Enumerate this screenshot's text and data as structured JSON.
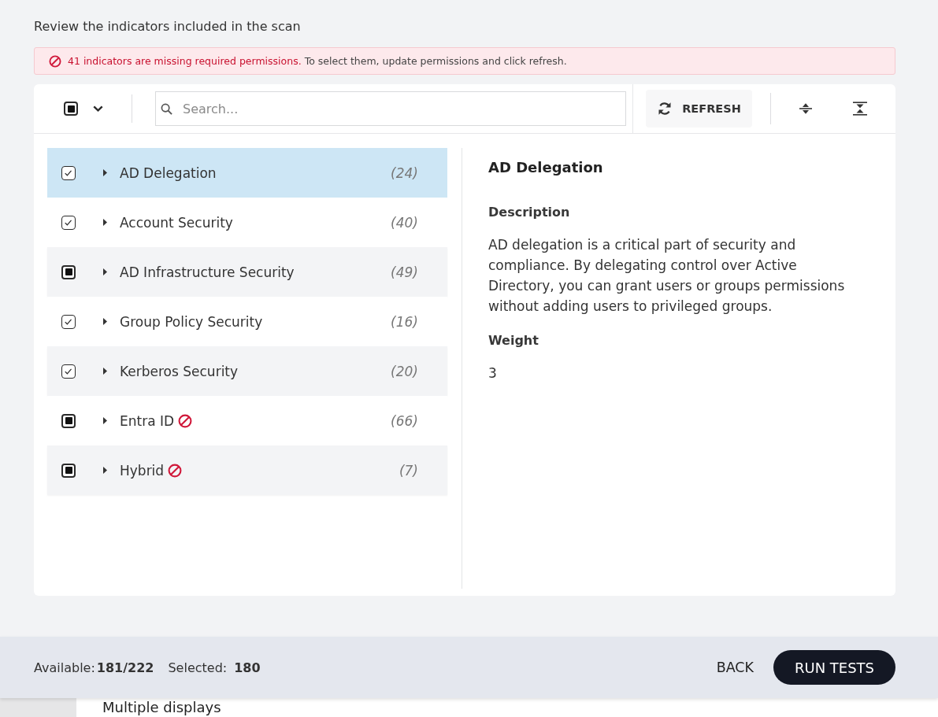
{
  "header": {
    "title": "Review the indicators included in the scan"
  },
  "alert": {
    "kind": "error",
    "message": "41 indicators are missing required permissions.",
    "hint": "To select them, update permissions and click refresh."
  },
  "toolbar": {
    "select_all": {
      "checked": false,
      "indeterminate": true
    },
    "search": {
      "placeholder": "Search..."
    },
    "refresh_button": "REFRESH"
  },
  "categories": [
    {
      "label": "AD Delegation",
      "count": "(24)",
      "checked": true,
      "indeterminate": false,
      "selected": true,
      "expanded": false,
      "missing_permissions": false
    },
    {
      "label": "Account Security",
      "count": "(40)",
      "checked": true,
      "indeterminate": false,
      "selected": false,
      "expanded": false,
      "missing_permissions": false
    },
    {
      "label": "AD Infrastructure Security",
      "count": "(49)",
      "checked": false,
      "indeterminate": true,
      "selected": false,
      "expanded": false,
      "missing_permissions": false
    },
    {
      "label": "Group Policy Security",
      "count": "(16)",
      "checked": true,
      "indeterminate": false,
      "selected": false,
      "expanded": false,
      "missing_permissions": false
    },
    {
      "label": "Kerberos Security",
      "count": "(20)",
      "checked": true,
      "indeterminate": false,
      "selected": false,
      "expanded": false,
      "missing_permissions": false
    },
    {
      "label": "Entra ID",
      "count": "(66)",
      "checked": false,
      "indeterminate": true,
      "selected": false,
      "expanded": false,
      "missing_permissions": true
    },
    {
      "label": "Hybrid",
      "count": "(7)",
      "checked": false,
      "indeterminate": true,
      "selected": false,
      "expanded": false,
      "missing_permissions": true
    }
  ],
  "details": {
    "title": "AD Delegation",
    "sections": [
      {
        "heading": "Description",
        "text": "AD delegation is a critical part of security and compliance. By delegating control over Active Directory, you can grant users or groups permissions without adding users to privileged groups."
      },
      {
        "heading": "Weight",
        "text": "3"
      }
    ]
  },
  "footer": {
    "available_label": "Available:",
    "available_value": "181/222",
    "selected_label": "Selected:",
    "selected_value": "180",
    "buttons": [
      {
        "label": "BACK",
        "kind": "text"
      },
      {
        "label": "RUN TESTS",
        "kind": "primary"
      }
    ]
  },
  "background_window": {
    "text": "Multiple displays"
  }
}
